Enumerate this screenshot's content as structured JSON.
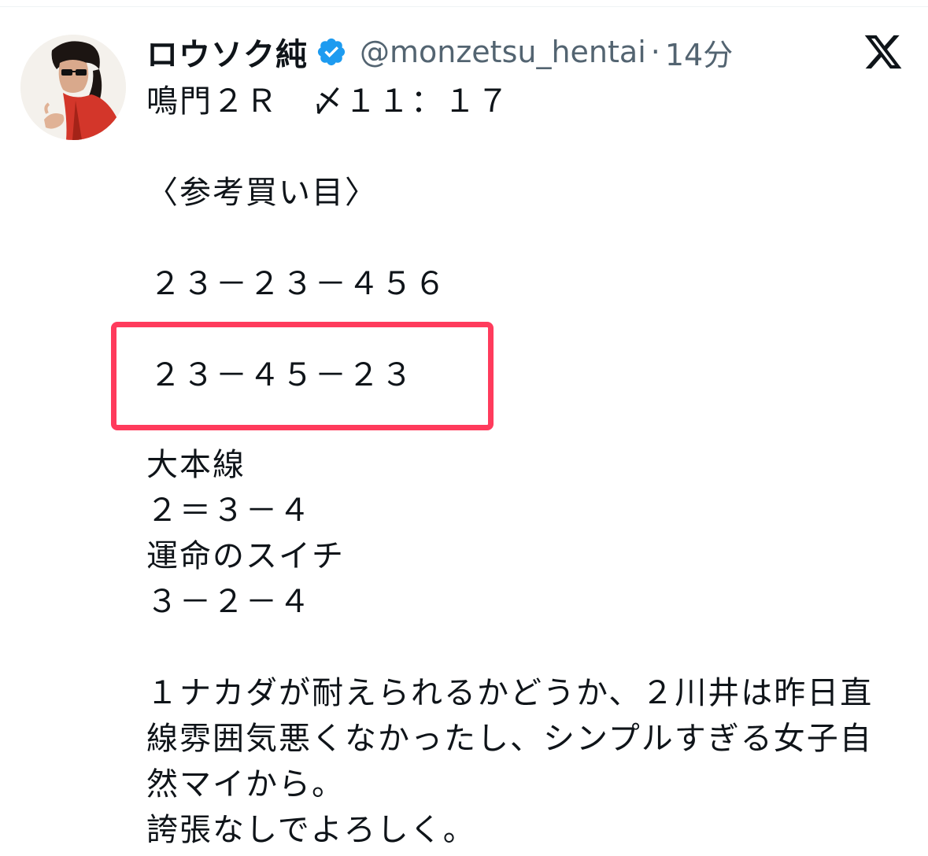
{
  "tweet": {
    "display_name": "ロウソク純",
    "handle": "@monzetsu_hentai",
    "separator": "·",
    "timestamp": "14分",
    "lines": [
      "鳴門２Ｒ　〆１１：１７",
      "〈参考買い目〉",
      "２３－２３－４５６",
      "２３－４５－２３",
      "大本線",
      "２＝３－４",
      "運命のスイチ",
      "３－２－４",
      "１ナカダが耐えられるかどうか、２川井は昨日直",
      "線雰囲気悪くなかったし、シンプルすぎる女子自",
      "然マイから。",
      "誇張なしでよろしく。"
    ]
  },
  "icons": {
    "verified": "verified-badge-icon",
    "brand": "x-logo-icon",
    "avatar": "user-avatar"
  },
  "colors": {
    "text_primary": "#0f1419",
    "text_secondary": "#536471",
    "verified_blue": "#1d9bf0",
    "highlight_red": "#ff3b5c"
  }
}
